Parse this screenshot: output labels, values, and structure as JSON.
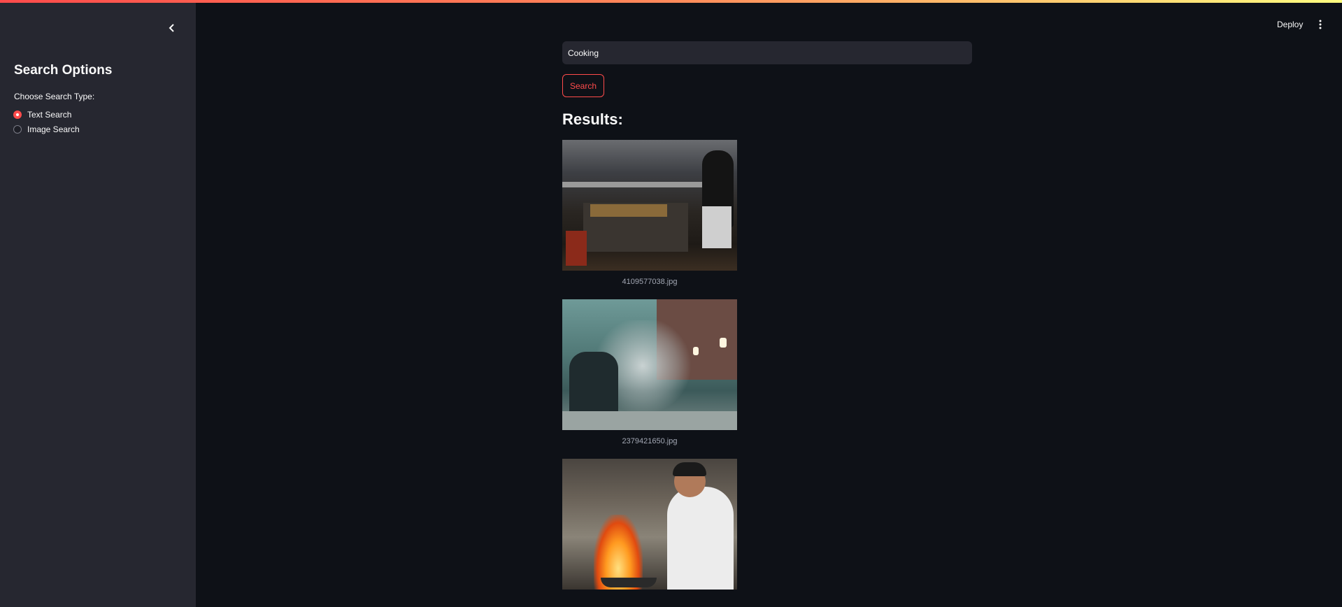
{
  "sidebar": {
    "title": "Search Options",
    "radio_group_label": "Choose Search Type:",
    "options": [
      {
        "label": "Text Search",
        "selected": true
      },
      {
        "label": "Image Search",
        "selected": false
      }
    ]
  },
  "header": {
    "deploy_label": "Deploy"
  },
  "search": {
    "value": "Cooking",
    "button_label": "Search"
  },
  "results": {
    "title": "Results:",
    "items": [
      {
        "caption": "4109577038.jpg"
      },
      {
        "caption": "2379421650.jpg"
      },
      {
        "caption": ""
      }
    ]
  },
  "colors": {
    "accent": "#ff4b4b",
    "sidebar_bg": "#262730",
    "main_bg": "#0e1117"
  }
}
